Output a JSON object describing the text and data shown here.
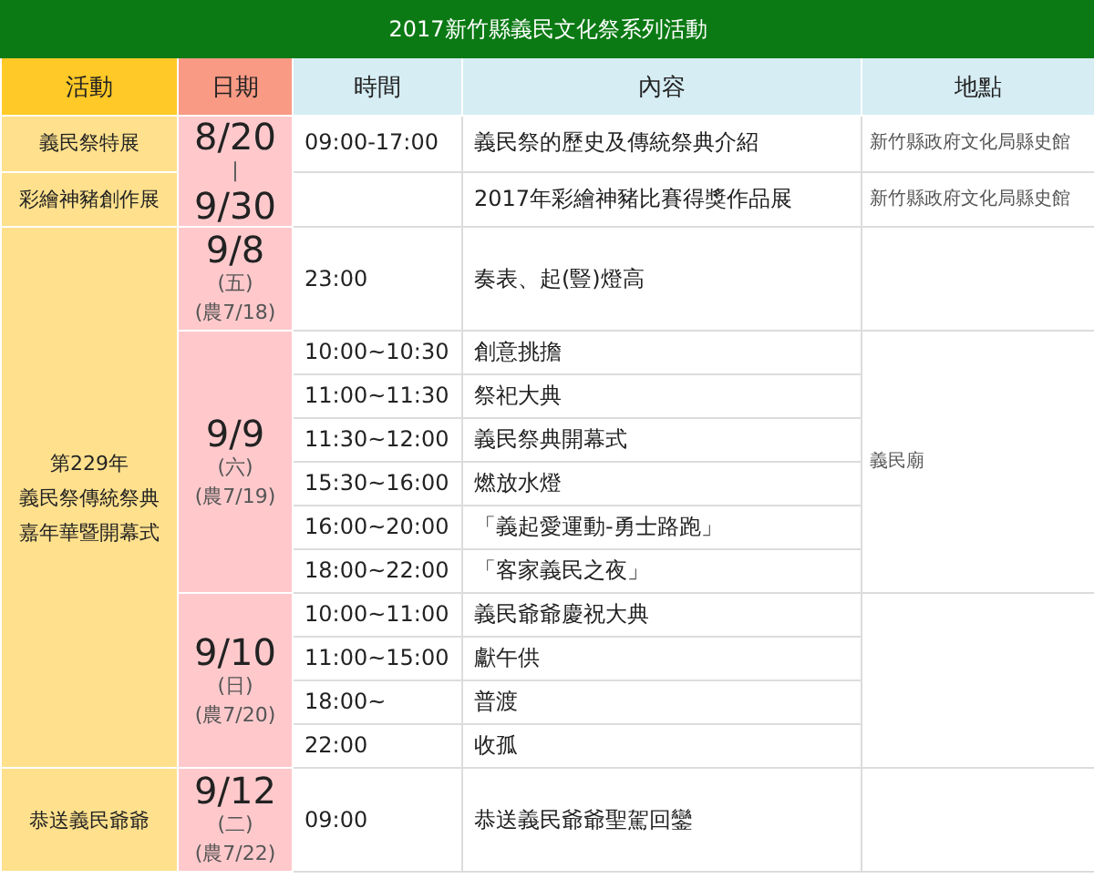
{
  "title": "2017新竹縣義民文化祭系列活動",
  "columns": [
    "活動",
    "日期",
    "時間",
    "內容",
    "地點"
  ],
  "sections": [
    {
      "kind": "shared_date",
      "date": [
        {
          "kind": "big",
          "text": "8/20"
        },
        {
          "kind": "small",
          "text": "|"
        },
        {
          "kind": "big",
          "text": "9/30"
        }
      ],
      "activities": [
        {
          "name": [
            "義民祭特展"
          ],
          "sessions": [
            {
              "time": "09:00-17:00",
              "content": "義民祭的歷史及傳統祭典介紹",
              "location": "新竹縣政府文化局縣史館"
            }
          ]
        },
        {
          "name": [
            "彩繪神豬創作展"
          ],
          "sessions": [
            {
              "content": "2017年彩繪神豬比賽得獎作品展",
              "location": "新竹縣政府文化局縣史館"
            }
          ]
        }
      ]
    },
    {
      "kind": "multi_day",
      "activity": [
        "第229年",
        "義民祭傳統祭典",
        "嘉年華暨開幕式"
      ],
      "days": [
        {
          "date": [
            {
              "kind": "big",
              "text": "9/8"
            },
            {
              "kind": "small",
              "text": "(五)"
            },
            {
              "kind": "small",
              "text": "(農7/18)"
            }
          ],
          "sessions": [
            {
              "time": "23:00",
              "content": "奏表、起(豎)燈高"
            }
          ]
        },
        {
          "date": [
            {
              "kind": "big",
              "text": "9/9"
            },
            {
              "kind": "small",
              "text": "(六)"
            },
            {
              "kind": "small",
              "text": "(農7/19)"
            }
          ],
          "location": "義民廟",
          "sessions": [
            {
              "time": "10:00~10:30",
              "content": "創意挑擔"
            },
            {
              "time": "11:00~11:30",
              "content": "祭祀大典"
            },
            {
              "time": "11:30~12:00",
              "content": "義民祭典開幕式"
            },
            {
              "time": "15:30~16:00",
              "content": "燃放水燈"
            },
            {
              "time": "16:00~20:00",
              "content": "「義起愛運動-勇士路跑」"
            },
            {
              "time": "18:00~22:00",
              "content": "「客家義民之夜」"
            }
          ]
        },
        {
          "date": [
            {
              "kind": "big",
              "text": "9/10"
            },
            {
              "kind": "small",
              "text": "(日)"
            },
            {
              "kind": "small",
              "text": "(農7/20)"
            }
          ],
          "sessions": [
            {
              "time": "10:00~11:00",
              "content": "義民爺爺慶祝大典"
            },
            {
              "time": "11:00~15:00",
              "content": "獻午供"
            },
            {
              "time": "18:00~",
              "content": "普渡"
            },
            {
              "time": "22:00",
              "content": "收孤"
            }
          ]
        }
      ]
    },
    {
      "kind": "multi_day",
      "activity": [
        "恭送義民爺爺"
      ],
      "days": [
        {
          "date": [
            {
              "kind": "big",
              "text": "9/12"
            },
            {
              "kind": "small",
              "text": "(二)"
            },
            {
              "kind": "small",
              "text": "(農7/22)"
            }
          ],
          "sessions": [
            {
              "time": "09:00",
              "content": "恭送義民爺爺聖駕回鑾"
            }
          ]
        }
      ]
    }
  ]
}
